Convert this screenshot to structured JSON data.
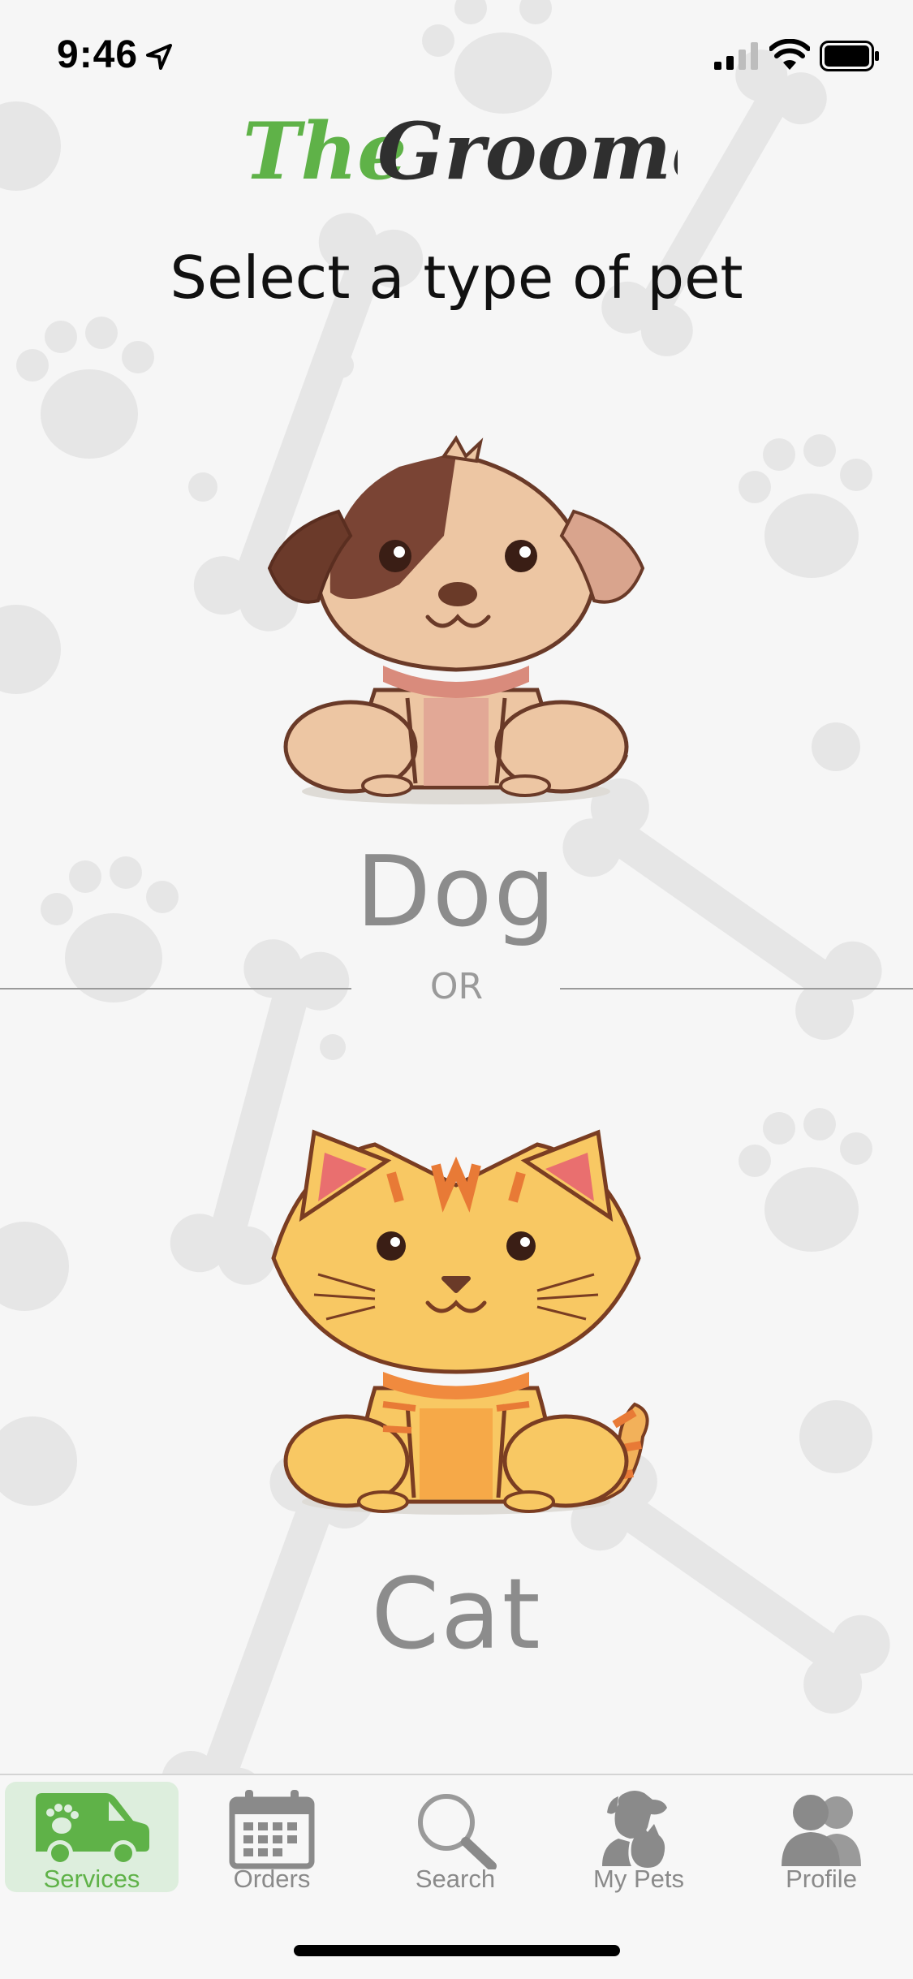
{
  "status_bar": {
    "time": "9:46"
  },
  "logo": {
    "part_the": "The",
    "part_groomers": "Groomers"
  },
  "prompt": "Select a type of pet",
  "pets": [
    {
      "label": "Dog",
      "icon": "dog-illustration"
    },
    {
      "label": "Cat",
      "icon": "cat-illustration"
    }
  ],
  "divider_text": "OR",
  "tabs": [
    {
      "label": "Services",
      "icon": "van-icon",
      "active": true
    },
    {
      "label": "Orders",
      "icon": "calendar-icon",
      "active": false
    },
    {
      "label": "Search",
      "icon": "magnifier-icon",
      "active": false
    },
    {
      "label": "My Pets",
      "icon": "pets-icon",
      "active": false
    },
    {
      "label": "Profile",
      "icon": "profile-icon",
      "active": false
    }
  ],
  "colors": {
    "brand_green": "#5fb248",
    "label_gray": "#8c8c8c",
    "background": "#f6f6f6"
  }
}
